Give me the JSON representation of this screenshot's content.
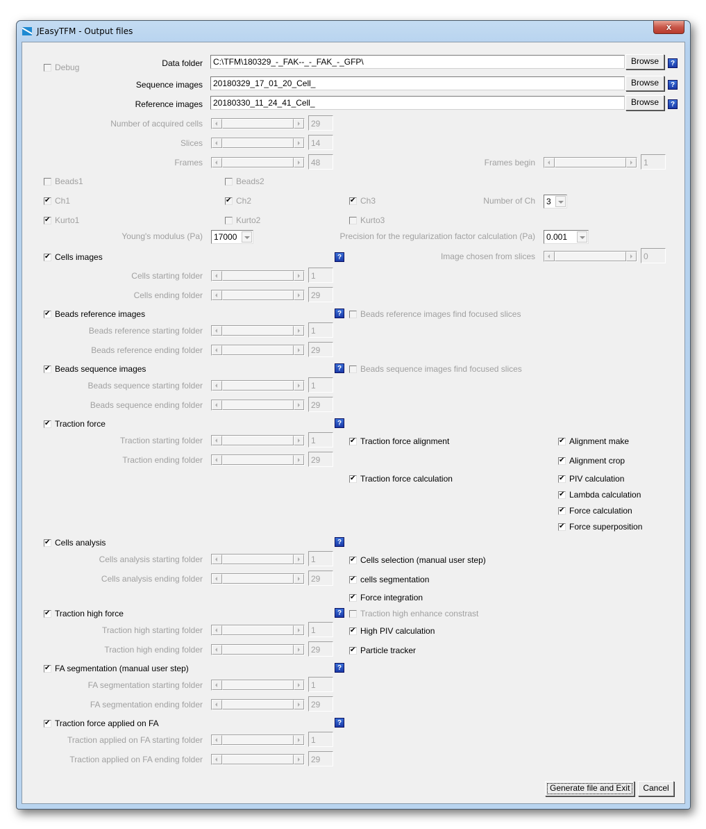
{
  "window": {
    "title": "JEasyTFM - Output files",
    "close_label": "x"
  },
  "debug": {
    "label": "Debug",
    "checked": false,
    "enabled": false
  },
  "paths": {
    "data_folder": {
      "label": "Data folder",
      "value": "C:\\TFM\\180329_-_FAK--_-_FAK_-_GFP\\",
      "browse": "Browse"
    },
    "sequence_images": {
      "label": "Sequence images",
      "value": "20180329_17_01_20_Cell_",
      "browse": "Browse"
    },
    "reference_images": {
      "label": "Reference images",
      "value": "20180330_11_24_41_Cell_",
      "browse": "Browse"
    }
  },
  "help_glyph": "?",
  "params": {
    "acquired_cells": {
      "label": "Number of acquired cells",
      "value": "29"
    },
    "slices": {
      "label": "Slices",
      "value": "14"
    },
    "frames": {
      "label": "Frames",
      "value": "48"
    },
    "frames_begin": {
      "label": "Frames begin",
      "value": "1"
    },
    "number_of_ch": {
      "label": "Number of Ch",
      "value": "3"
    },
    "youngs_modulus": {
      "label": "Young's modulus (Pa)",
      "value": "17000"
    },
    "precision": {
      "label": "Precision for the regularization factor calculation (Pa)",
      "value": "0.001"
    },
    "image_from_slices": {
      "label": "Image chosen from slices",
      "value": "0"
    }
  },
  "channels": {
    "beads1": {
      "label": "Beads1",
      "checked": false
    },
    "beads2": {
      "label": "Beads2",
      "checked": false
    },
    "ch1": {
      "label": "Ch1",
      "checked": true
    },
    "ch2": {
      "label": "Ch2",
      "checked": true
    },
    "ch3": {
      "label": "Ch3",
      "checked": true
    },
    "kurto1": {
      "label": "Kurto1",
      "checked": true
    },
    "kurto2": {
      "label": "Kurto2",
      "checked": false
    },
    "kurto3": {
      "label": "Kurto3",
      "checked": false
    }
  },
  "sections": {
    "cells_images": {
      "label": "Cells images",
      "checked": true,
      "start": {
        "label": "Cells starting folder",
        "value": "1"
      },
      "end": {
        "label": "Cells ending folder",
        "value": "29"
      }
    },
    "beads_reference": {
      "label": "Beads reference images",
      "checked": true,
      "focused": {
        "label": "Beads reference images find focused slices",
        "checked": false
      },
      "start": {
        "label": "Beads reference starting folder",
        "value": "1"
      },
      "end": {
        "label": "Beads reference ending folder",
        "value": "29"
      }
    },
    "beads_sequence": {
      "label": "Beads sequence images",
      "checked": true,
      "focused": {
        "label": "Beads sequence images find focused slices",
        "checked": false
      },
      "start": {
        "label": "Beads sequence starting folder",
        "value": "1"
      },
      "end": {
        "label": "Beads sequence ending folder",
        "value": "29"
      }
    },
    "traction_force": {
      "label": "Traction force",
      "checked": true,
      "start": {
        "label": "Traction starting folder",
        "value": "1"
      },
      "end": {
        "label": "Traction ending folder",
        "value": "29"
      },
      "alignment": {
        "label": "Traction force alignment",
        "checked": true
      },
      "calculation": {
        "label": "Traction force calculation",
        "checked": true
      },
      "alignment_make": {
        "label": "Alignment make",
        "checked": true
      },
      "alignment_crop": {
        "label": "Alignment crop",
        "checked": true
      },
      "piv": {
        "label": "PIV        calculation",
        "checked": true
      },
      "lambda": {
        "label": "Lambda calculation",
        "checked": true
      },
      "force": {
        "label": "Force     calculation",
        "checked": true
      },
      "superposition": {
        "label": "Force superposition",
        "checked": true
      }
    },
    "cells_analysis": {
      "label": "Cells analysis",
      "checked": true,
      "start": {
        "label": "Cells analysis starting folder",
        "value": "1"
      },
      "end": {
        "label": "Cells analysis ending folder",
        "value": "29"
      },
      "selection": {
        "label": "Cells selection (manual user step)",
        "checked": true
      },
      "segmentation": {
        "label": "cells segmentation",
        "checked": true
      },
      "integration": {
        "label": "Force integration",
        "checked": true
      }
    },
    "traction_high": {
      "label": "Traction high force",
      "checked": true,
      "enhance": {
        "label": "Traction high enhance constrast",
        "checked": false
      },
      "start": {
        "label": "Traction high starting folder",
        "value": "1"
      },
      "end": {
        "label": "Traction high ending folder",
        "value": "29"
      },
      "high_piv": {
        "label": "High PIV calculation",
        "checked": true
      },
      "particle": {
        "label": "Particle tracker",
        "checked": true
      }
    },
    "fa_segmentation": {
      "label": "FA segmentation (manual user step)",
      "checked": true,
      "start": {
        "label": "FA segmentation starting folder",
        "value": "1"
      },
      "end": {
        "label": "FA segmentation ending folder",
        "value": "29"
      }
    },
    "traction_fa": {
      "label": "Traction force applied on FA",
      "checked": true,
      "start": {
        "label": "Traction applied on FA starting folder",
        "value": "1"
      },
      "end": {
        "label": "Traction applied on FA ending folder",
        "value": "29"
      }
    }
  },
  "footer": {
    "generate": "Generate file and Exit",
    "cancel": "Cancel"
  }
}
